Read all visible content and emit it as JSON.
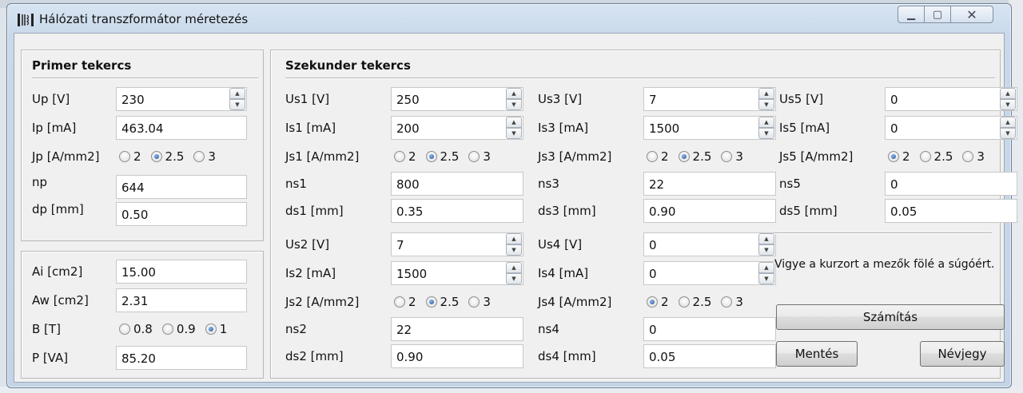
{
  "window": {
    "title": "Hálózati transzformátor méretezés"
  },
  "primary": {
    "title": "Primer tekercs",
    "up": {
      "label": "Up [V]",
      "value": "230"
    },
    "ip": {
      "label": "Ip [mA]",
      "value": "463.04"
    },
    "jp": {
      "label": "Jp [A/mm2]",
      "options": [
        "2",
        "2.5",
        "3"
      ],
      "selected": "2.5"
    },
    "np": {
      "label": "np",
      "value": "644"
    },
    "dp": {
      "label": "dp [mm]",
      "value": "0.50"
    }
  },
  "core": {
    "ai": {
      "label": "Ai [cm2]",
      "value": "15.00"
    },
    "aw": {
      "label": "Aw [cm2]",
      "value": "2.31"
    },
    "b": {
      "label": "B [T]",
      "options": [
        "0.8",
        "0.9",
        "1"
      ],
      "selected": "1"
    },
    "p": {
      "label": "P [VA]",
      "value": "85.20"
    }
  },
  "secondary": {
    "title": "Szekunder tekercs",
    "s1": {
      "us_label": "Us1 [V]",
      "us": "250",
      "is_label": "Is1 [mA]",
      "is": "200",
      "js_label": "Js1 [A/mm2]",
      "js_selected": "2.5",
      "n_label": "ns1",
      "n": "800",
      "d_label": "ds1 [mm]",
      "d": "0.35"
    },
    "s2": {
      "us_label": "Us2 [V]",
      "us": "7",
      "is_label": "Is2 [mA]",
      "is": "1500",
      "js_label": "Js2 [A/mm2]",
      "js_selected": "2.5",
      "n_label": "ns2",
      "n": "22",
      "d_label": "ds2 [mm]",
      "d": "0.90"
    },
    "s3": {
      "us_label": "Us3 [V]",
      "us": "7",
      "is_label": "Is3 [mA]",
      "is": "1500",
      "js_label": "Js3 [A/mm2]",
      "js_selected": "2.5",
      "n_label": "ns3",
      "n": "22",
      "d_label": "ds3 [mm]",
      "d": "0.90"
    },
    "s4": {
      "us_label": "Us4 [V]",
      "us": "0",
      "is_label": "Is4 [mA]",
      "is": "0",
      "js_label": "Js4 [A/mm2]",
      "js_selected": "2",
      "n_label": "ns4",
      "n": "0",
      "d_label": "ds4 [mm]",
      "d": "0.05"
    },
    "s5": {
      "us_label": "Us5 [V]",
      "us": "0",
      "is_label": "Is5 [mA]",
      "is": "0",
      "js_label": "Js5 [A/mm2]",
      "js_selected": "2",
      "n_label": "ns5",
      "n": "0",
      "d_label": "ds5 [mm]",
      "d": "0.05"
    },
    "js_options": [
      "2",
      "2.5",
      "3"
    ]
  },
  "hint": "Vigye a kurzort a mezők fölé a súgóért.",
  "buttons": {
    "calc": "Számítás",
    "save": "Mentés",
    "about": "Névjegy"
  }
}
